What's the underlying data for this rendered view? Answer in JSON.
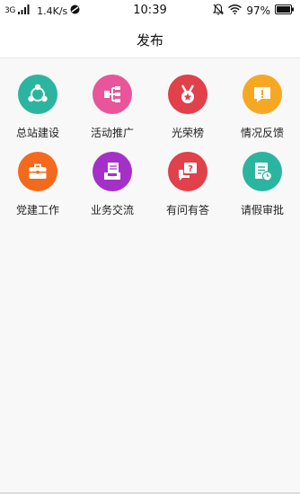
{
  "status_bar": {
    "network": "3G",
    "speed": "1.4K/s",
    "time": "10:39",
    "battery": "97%"
  },
  "header": {
    "title": "发布"
  },
  "grid": {
    "items": [
      {
        "label": "总站建设",
        "icon": "network-nodes-icon",
        "color": "#2bb5a0"
      },
      {
        "label": "活动推广",
        "icon": "tree-structure-icon",
        "color": "#e8559a"
      },
      {
        "label": "光荣榜",
        "icon": "medal-icon",
        "color": "#e0414b"
      },
      {
        "label": "情况反馈",
        "icon": "feedback-bubble-icon",
        "color": "#f7a823"
      },
      {
        "label": "党建工作",
        "icon": "briefcase-icon",
        "color": "#f46a1d"
      },
      {
        "label": "业务交流",
        "icon": "document-tray-icon",
        "color": "#a530c8"
      },
      {
        "label": "有问有答",
        "icon": "question-chat-icon",
        "color": "#e0414b"
      },
      {
        "label": "请假审批",
        "icon": "clock-form-icon",
        "color": "#2bb5a0"
      }
    ]
  }
}
